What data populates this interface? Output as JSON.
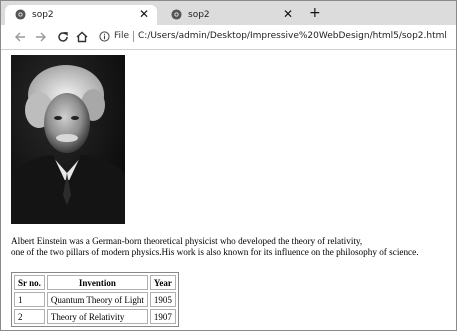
{
  "tabs": [
    {
      "title": "sop2",
      "close": "✕",
      "icon": "chrome-page-icon"
    },
    {
      "title": "sop2",
      "close": "✕",
      "icon": "chrome-page-icon"
    }
  ],
  "new_tab_label": "+",
  "toolbar": {
    "file_label": "File",
    "url": "C:/Users/admin/Desktop/Impressive%20WebDesign/html5/sop2.html"
  },
  "page": {
    "paragraph_line1": "Albert Einstein was a German-born theoretical physicist who developed the theory of relativity,",
    "paragraph_line2": "one of the two pillars of modern physics.His work is also known for its influence on the philosophy of science.",
    "table": {
      "headers": [
        "Sr no.",
        "Invention",
        "Year"
      ],
      "rows": [
        [
          "1",
          "Quantum Theory of Light",
          "1905"
        ],
        [
          "2",
          "Theory of Relativity",
          "1907"
        ]
      ]
    }
  }
}
